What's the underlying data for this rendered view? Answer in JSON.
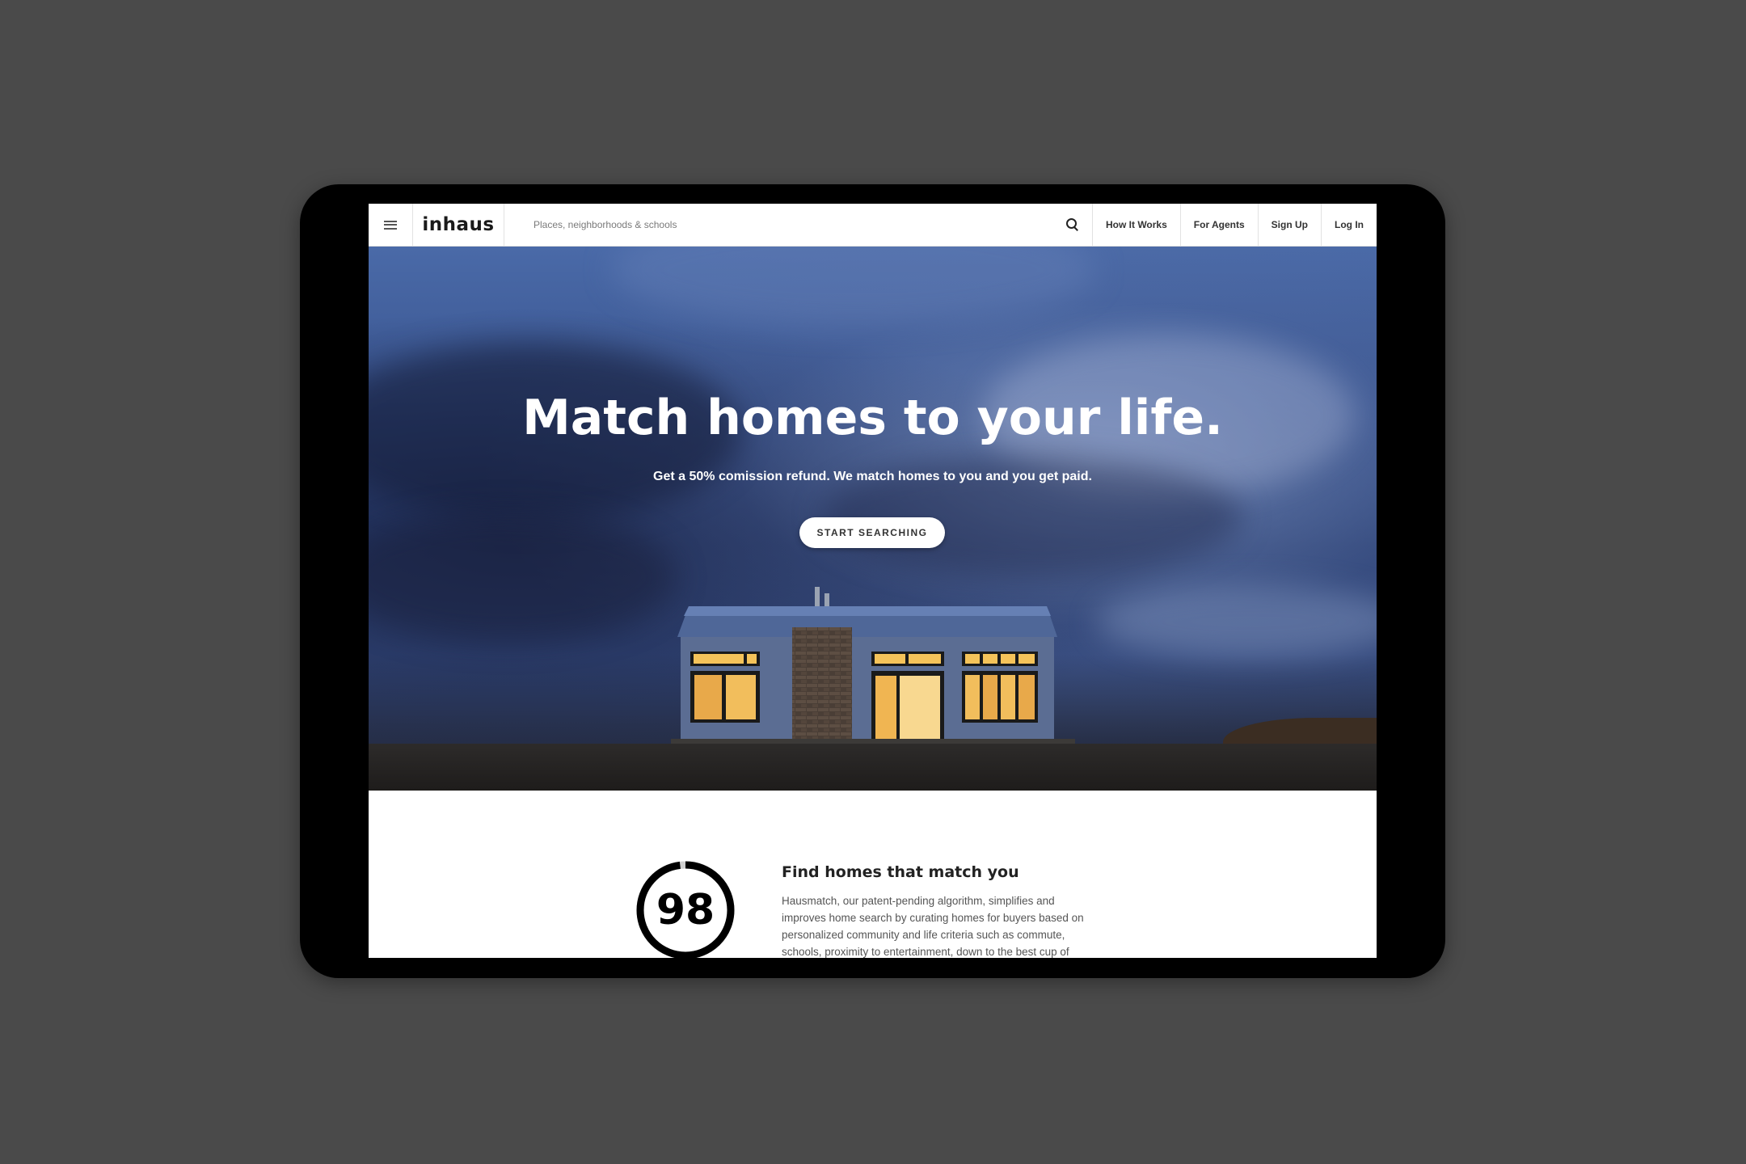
{
  "nav": {
    "logo": "inhaus",
    "search_placeholder": "Places, neighborhoods & schools",
    "links": [
      "How It Works",
      "For Agents",
      "Sign Up",
      "Log In"
    ]
  },
  "hero": {
    "title": "Match homes to your life.",
    "subtitle": "Get a 50% comission refund. We match homes to you and you get paid.",
    "cta_label": "START SEARCHING"
  },
  "feature": {
    "score": "98",
    "score_fraction": 0.98,
    "title": "Find homes that match you",
    "body": "Hausmatch, our patent-pending algorithm, simplifies and improves home search by curating homes for buyers based on personalized community and life criteria such as commute, schools, proximity to entertainment, down to the best cup of"
  },
  "colors": {
    "page_background": "#4a4a4a",
    "device_frame": "#000000",
    "nav_background": "#ffffff",
    "hero_sky": "#3a5590",
    "window_glow": "#f5c35a"
  },
  "icons": {
    "menu": "hamburger-menu-icon",
    "search": "search-icon"
  }
}
